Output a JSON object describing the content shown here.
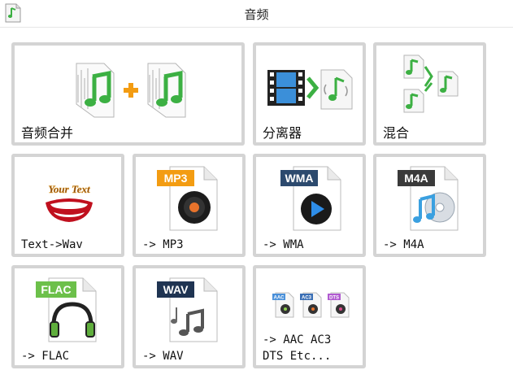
{
  "window": {
    "title": "音频"
  },
  "tiles": [
    {
      "label": "音频合并",
      "icon": "music-merge-icon"
    },
    {
      "label": "分离器",
      "icon": "video-splitter-icon"
    },
    {
      "label": "混合",
      "icon": "audio-mix-icon"
    },
    {
      "label": "Text->Wav",
      "icon": "text-to-speech-icon"
    },
    {
      "label": "-> MP3",
      "icon": "mp3-file-icon",
      "badge": "MP3"
    },
    {
      "label": "-> WMA",
      "icon": "wma-file-icon",
      "badge": "WMA"
    },
    {
      "label": "-> M4A",
      "icon": "m4a-file-icon",
      "badge": "M4A"
    },
    {
      "label": "-> FLAC",
      "icon": "flac-file-icon",
      "badge": "FLAC"
    },
    {
      "label": "-> WAV",
      "icon": "wav-file-icon",
      "badge": "WAV"
    },
    {
      "label": "-> AAC AC3\nDTS Etc...",
      "icon": "multi-format-icon",
      "badges": [
        "AAC",
        "AC3",
        "DTS"
      ]
    }
  ],
  "tts_icon_text": "Your Text",
  "colors": {
    "tile_border": "#d4d4d4",
    "note_green": "#3cb043",
    "plus_orange": "#f39c12"
  }
}
